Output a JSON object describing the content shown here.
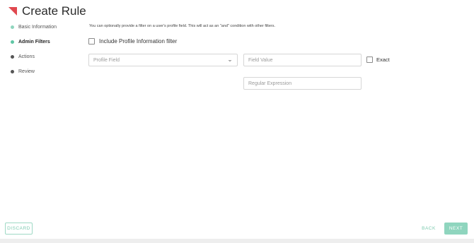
{
  "header": {
    "title": "Create Rule",
    "logo_icon": "red-triangle-logo"
  },
  "steps": [
    {
      "label": "Basic Information",
      "state": "done"
    },
    {
      "label": "Admin Filters",
      "state": "active"
    },
    {
      "label": "Actions",
      "state": "pending"
    },
    {
      "label": "Review",
      "state": "pending"
    }
  ],
  "main": {
    "intro": "You can optionally provide a filter on a user's profile field. This will act as an \"and\" condition with other filters.",
    "include_checkbox_label": "Include Profile Information filter",
    "profile_field_placeholder": "Profile Field",
    "field_value_placeholder": "Field Value",
    "exact_label": "Exact",
    "regex_placeholder": "Regular Expression"
  },
  "footer": {
    "discard": "DISCARD",
    "back": "BACK",
    "next": "NEXT"
  },
  "colors": {
    "accent": "#8fd5be",
    "logo": "#e0484f"
  }
}
